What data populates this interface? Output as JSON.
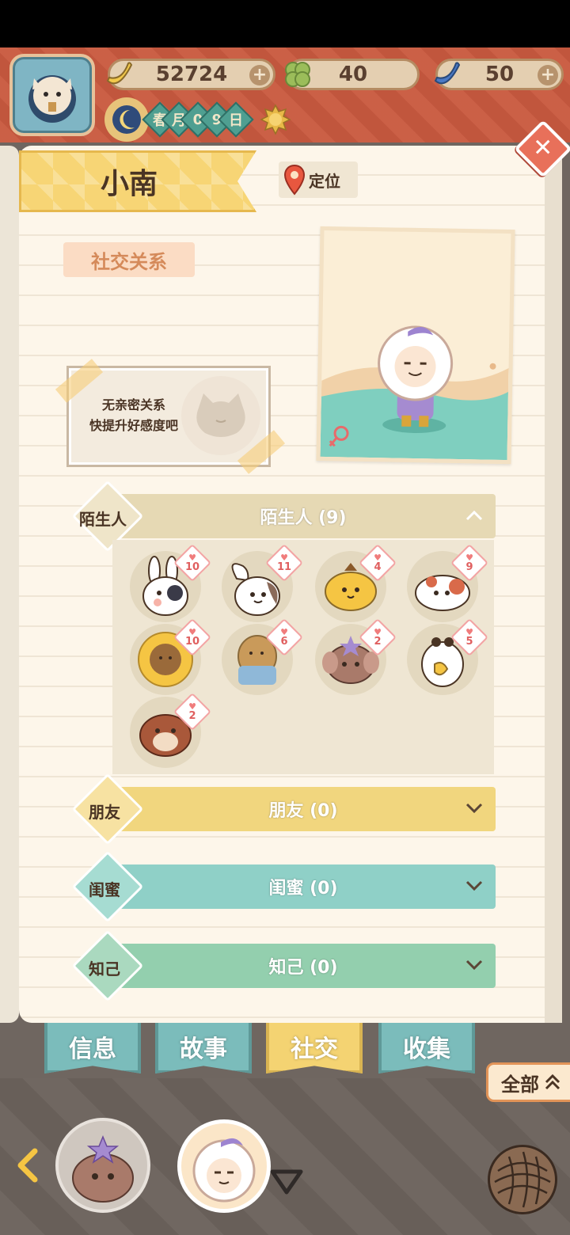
{
  "header": {
    "resources": [
      {
        "name": "banana",
        "value": "52724",
        "icon": "banana-icon",
        "has_plus": true
      },
      {
        "name": "clover",
        "value": "40",
        "icon": "clover-icon",
        "has_plus": false
      },
      {
        "name": "blue-banana",
        "value": "50",
        "icon": "blue-banana-icon",
        "has_plus": true
      }
    ],
    "date_chars": [
      "春",
      "月",
      "0",
      "9",
      "日"
    ]
  },
  "profile": {
    "name": "小南",
    "locate_label": "定位",
    "section_label": "社交关系",
    "no_intimate_line1": "无亲密关系",
    "no_intimate_line2": "快提升好感度吧"
  },
  "categories": [
    {
      "key": "stranger",
      "diamond_label": "陌生人",
      "title": "陌生人 (9)",
      "expanded": true,
      "color": "#e6d9b4"
    },
    {
      "key": "friend",
      "diamond_label": "朋友",
      "title": "朋友 (0)",
      "expanded": false,
      "color": "#f1d67e"
    },
    {
      "key": "bestie",
      "diamond_label": "闺蜜",
      "title": "闺蜜 (0)",
      "expanded": false,
      "color": "#8fd0c7"
    },
    {
      "key": "confidant",
      "diamond_label": "知己",
      "title": "知己 (0)",
      "expanded": false,
      "color": "#93cfae"
    }
  ],
  "strangers": [
    {
      "creature": "bunny-patch",
      "hearts": "10"
    },
    {
      "creature": "bunny-lop",
      "hearts": "11"
    },
    {
      "creature": "pudding-dog",
      "hearts": "4"
    },
    {
      "creature": "spotted-cat",
      "hearts": "9"
    },
    {
      "creature": "sunflower",
      "hearts": "10"
    },
    {
      "creature": "potato-jeans",
      "hearts": "6"
    },
    {
      "creature": "elephant",
      "hearts": "2"
    },
    {
      "creature": "parrot",
      "hearts": "5"
    },
    {
      "creature": "hamster",
      "hearts": "2"
    }
  ],
  "tabs": [
    {
      "label": "信息",
      "active": false
    },
    {
      "label": "故事",
      "active": false
    },
    {
      "label": "社交",
      "active": true
    },
    {
      "label": "收集",
      "active": false
    }
  ],
  "filter": {
    "label": "全部"
  }
}
